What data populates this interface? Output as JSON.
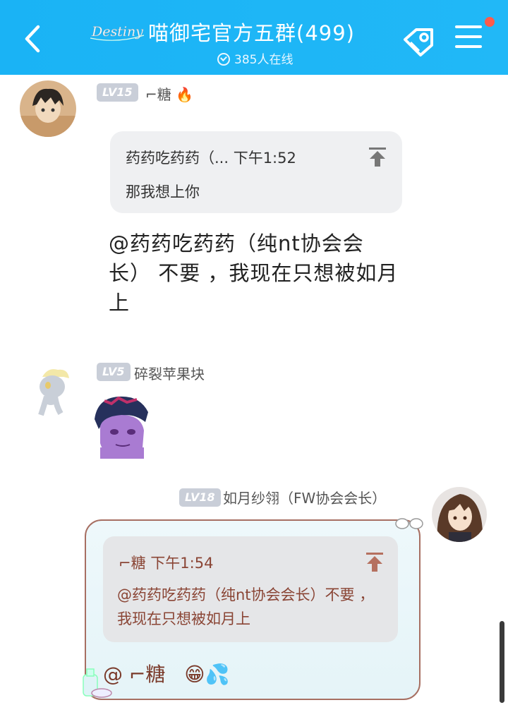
{
  "header": {
    "logo_text": "Destiny",
    "title": "喵御宅官方五群(499)",
    "online": "385人在线"
  },
  "messages": [
    {
      "level": "LV15",
      "name": "⌐糖",
      "quote_header": "药药吃药药（...  下午1:52",
      "quote_body": "那我想上你",
      "text": "@药药吃药药（纯nt协会会长） 不要 ，我现在只想被如月上"
    },
    {
      "level": "LV5",
      "name": "碎裂苹果块"
    },
    {
      "level": "LV18",
      "name": "如月纱翎（FW协会会长）",
      "quote_header": "⌐糖  下午1:54",
      "quote_body": "@药药吃药药（纯nt协会会长）不要 ，我现在只想被如月上",
      "text": "@ ⌐糖"
    }
  ],
  "colors": {
    "header": "#1ab3f5",
    "level_badge": "#c9ced8",
    "bubble_border": "#a76f62",
    "bubble_text": "#8a4535"
  }
}
